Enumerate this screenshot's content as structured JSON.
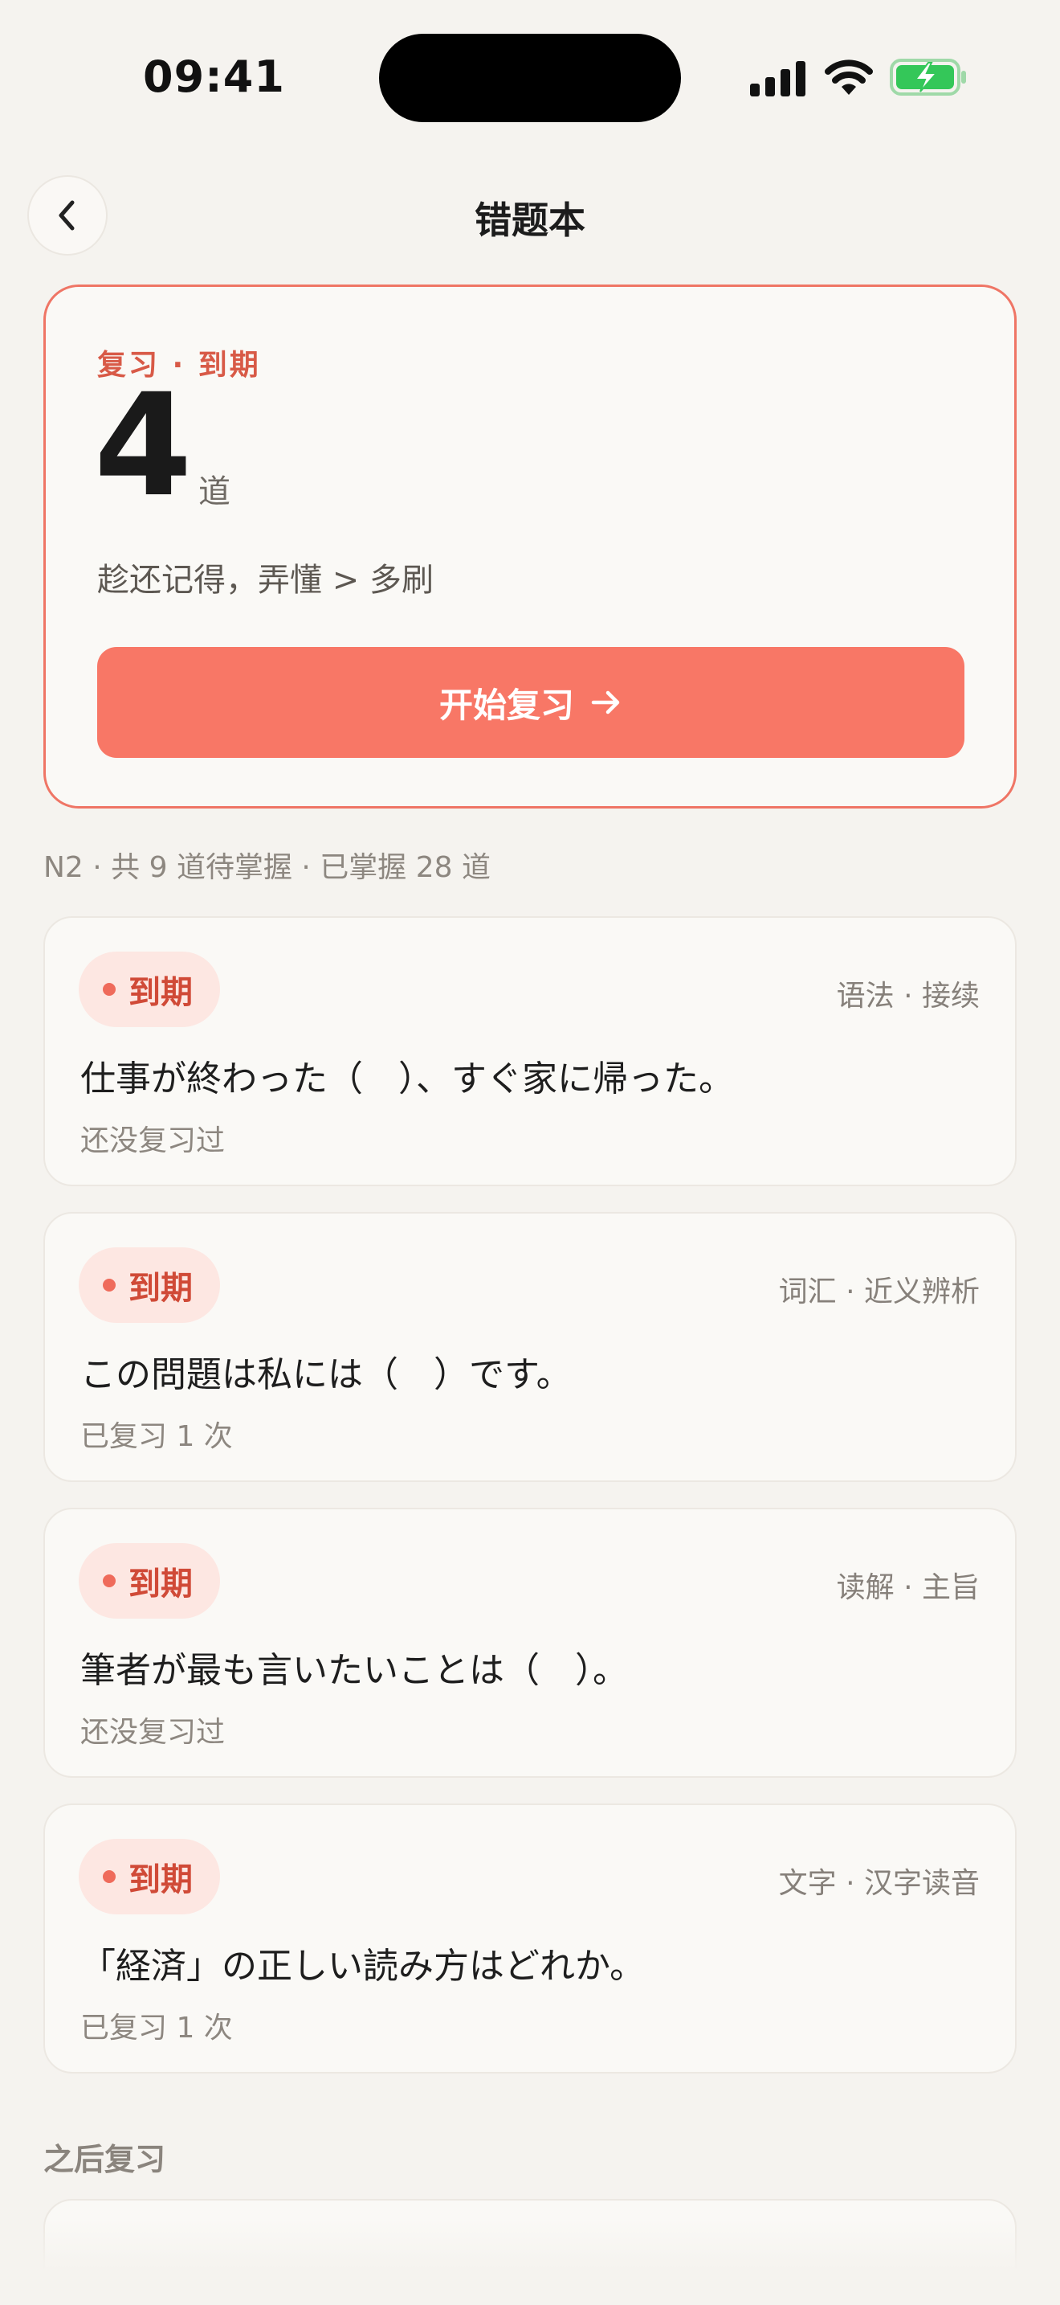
{
  "status_bar": {
    "time": "09:41",
    "icons": [
      "cellular-signal-icon",
      "wifi-icon",
      "battery-charging-icon"
    ],
    "battery_color": "#34c759"
  },
  "nav": {
    "back_icon": "chevron-left-icon",
    "title": "错题本"
  },
  "hero": {
    "eyebrow": "复习 · 到期",
    "count": "4",
    "unit": "道",
    "tip": "趁还记得，弄懂 > 多刷",
    "button_label": "开始复习",
    "button_icon": "arrow-right-icon",
    "accent_color": "#f87766"
  },
  "summary": "N2 · 共 9 道待掌握 · 已掌握 28 道",
  "questions": [
    {
      "badge": "到期",
      "category": "语法 · 接续",
      "text": "仕事が終わった（　）、すぐ家に帰った。",
      "status": "还没复习过"
    },
    {
      "badge": "到期",
      "category": "词汇 · 近义辨析",
      "text": "この問題は私には（　）です。",
      "status": "已复习 1 次"
    },
    {
      "badge": "到期",
      "category": "读解 · 主旨",
      "text": "筆者が最も言いたいことは（　）。",
      "status": "还没复习过"
    },
    {
      "badge": "到期",
      "category": "文字 · 汉字读音",
      "text": "「経済」の正しい読み方はどれか。",
      "status": "已复习 1 次"
    }
  ],
  "later_section": {
    "title": "之后复习"
  }
}
